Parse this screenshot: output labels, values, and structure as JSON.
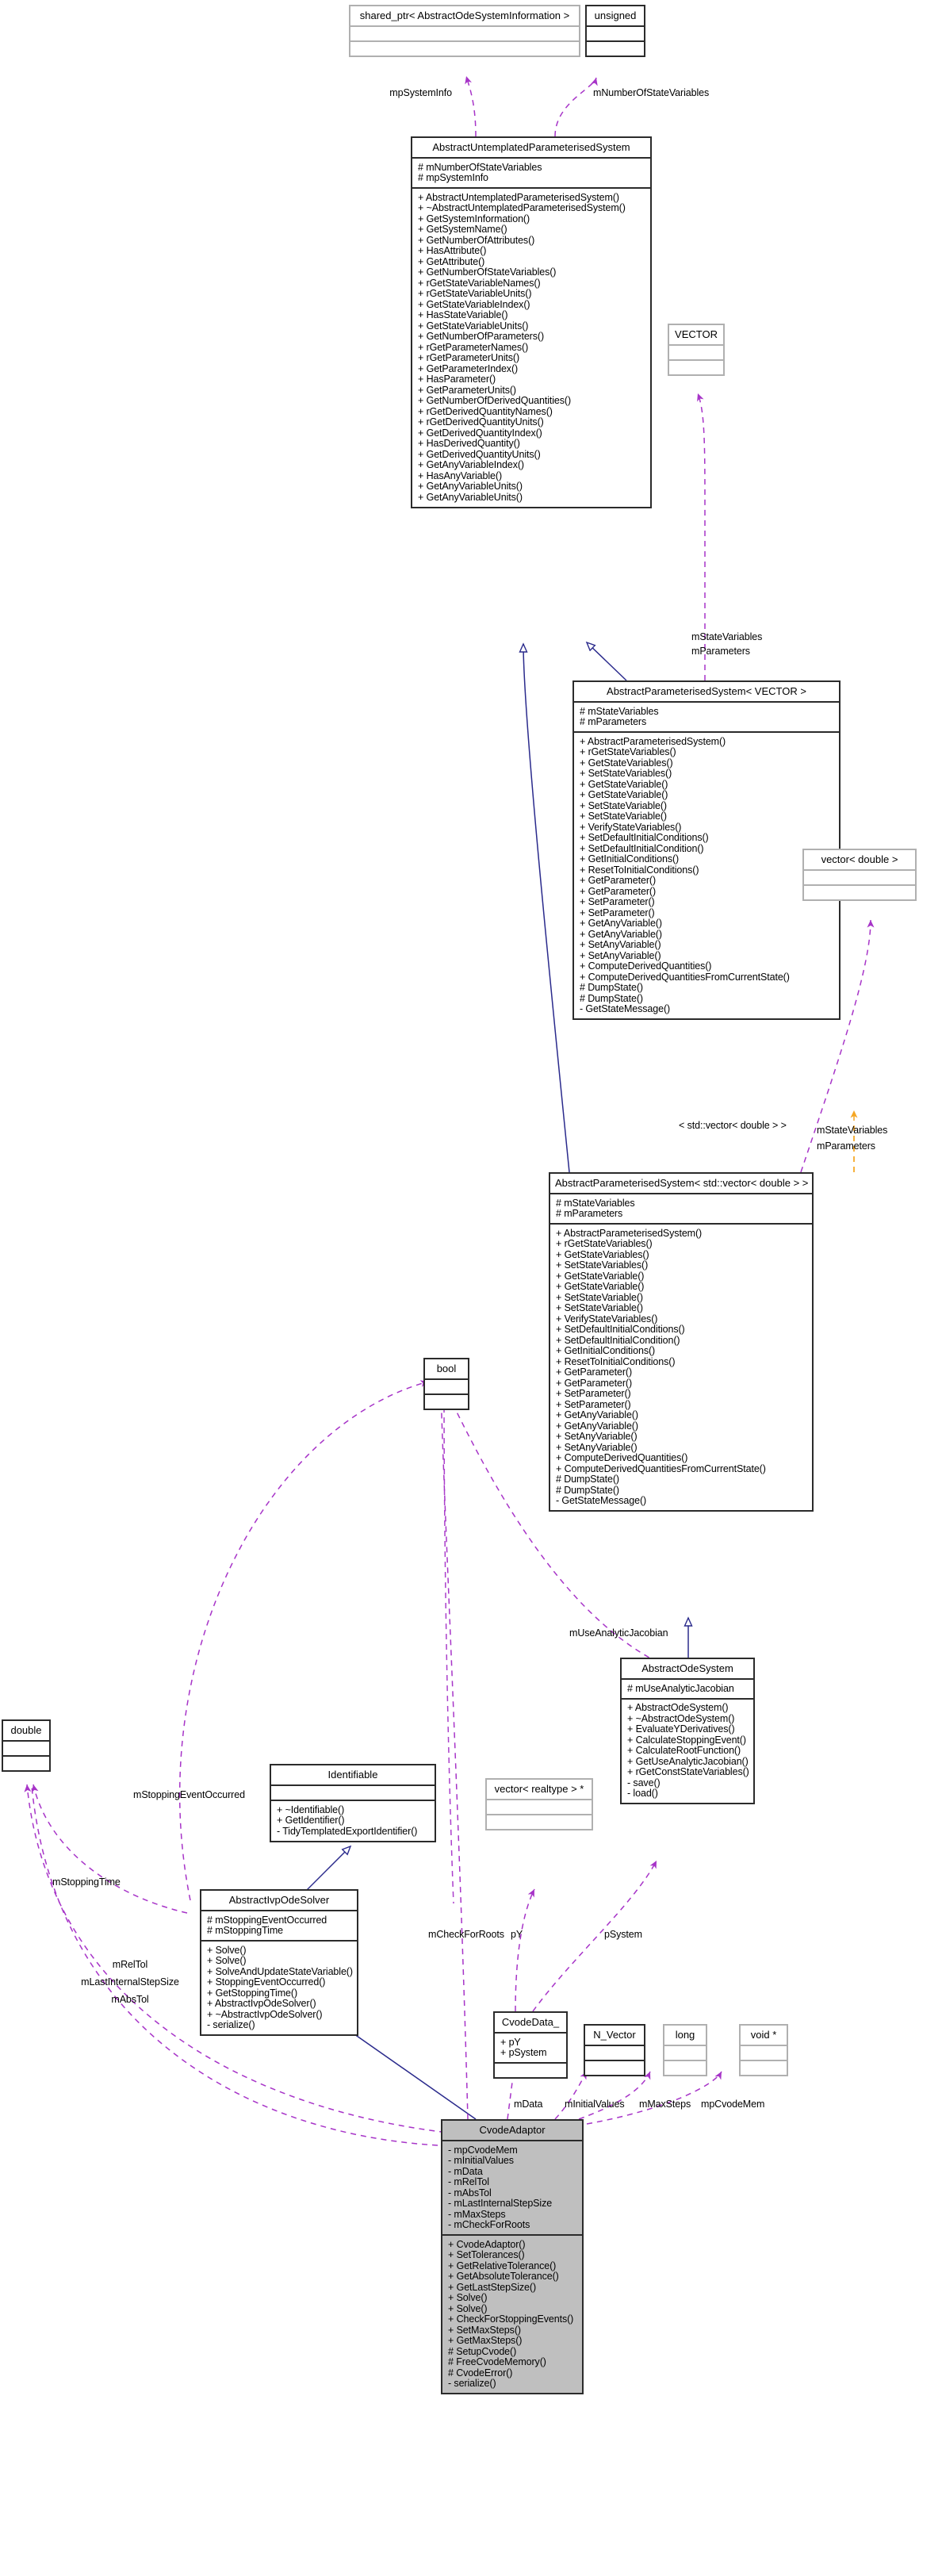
{
  "diagram": {
    "kind": "uml-collaboration-diagram",
    "root_class": "CvodeAdaptor",
    "colors": {
      "node_border": "#2b2b2b",
      "node_border_light": "#b0b0b0",
      "node_fill": "#ffffff",
      "root_fill": "#bfbfbf",
      "inheritance_edge": "#2a2a8c",
      "usage_edge": "#a734c8",
      "template_edge": "#f5a623",
      "background": "#ffffff"
    }
  },
  "nodes": {
    "shared_ptr_info": {
      "title": "shared_ptr< AbstractOdeSystemInformation >",
      "attributes": [],
      "operations": []
    },
    "unsigned": {
      "title": "unsigned",
      "attributes": [],
      "operations": []
    },
    "aups": {
      "title": "AbstractUntemplatedParameterisedSystem",
      "attributes": [
        "# mNumberOfStateVariables",
        "# mpSystemInfo"
      ],
      "operations": [
        "+ AbstractUntemplatedParameterisedSystem()",
        "+ ~AbstractUntemplatedParameterisedSystem()",
        "+ GetSystemInformation()",
        "+ GetSystemName()",
        "+ GetNumberOfAttributes()",
        "+ HasAttribute()",
        "+ GetAttribute()",
        "+ GetNumberOfStateVariables()",
        "+ rGetStateVariableNames()",
        "+ rGetStateVariableUnits()",
        "+ GetStateVariableIndex()",
        "+ HasStateVariable()",
        "+ GetStateVariableUnits()",
        "+ GetNumberOfParameters()",
        "+ rGetParameterNames()",
        "+ rGetParameterUnits()",
        "+ GetParameterIndex()",
        "+ HasParameter()",
        "+ GetParameterUnits()",
        "+ GetNumberOfDerivedQuantities()",
        "+ rGetDerivedQuantityNames()",
        "+ rGetDerivedQuantityUnits()",
        "+ GetDerivedQuantityIndex()",
        "+ HasDerivedQuantity()",
        "+ GetDerivedQuantityUnits()",
        "+ GetAnyVariableIndex()",
        "+ HasAnyVariable()",
        "+ GetAnyVariableUnits()",
        "+ GetAnyVariableUnits()"
      ]
    },
    "vector_tpl": {
      "title": "VECTOR",
      "attributes": [],
      "operations": []
    },
    "aps_vector": {
      "title": "AbstractParameterisedSystem< VECTOR >",
      "attributes": [
        "# mStateVariables",
        "# mParameters"
      ],
      "operations": [
        "+ AbstractParameterisedSystem()",
        "+ rGetStateVariables()",
        "+ GetStateVariables()",
        "+ SetStateVariables()",
        "+ GetStateVariable()",
        "+ GetStateVariable()",
        "+ SetStateVariable()",
        "+ SetStateVariable()",
        "+ VerifyStateVariables()",
        "+ SetDefaultInitialConditions()",
        "+ SetDefaultInitialCondition()",
        "+ GetInitialConditions()",
        "+ ResetToInitialConditions()",
        "+ GetParameter()",
        "+ GetParameter()",
        "+ SetParameter()",
        "+ SetParameter()",
        "+ GetAnyVariable()",
        "+ GetAnyVariable()",
        "+ SetAnyVariable()",
        "+ SetAnyVariable()",
        "+ ComputeDerivedQuantities()",
        "+ ComputeDerivedQuantitiesFromCurrentState()",
        "# DumpState()",
        "# DumpState()",
        "- GetStateMessage()"
      ]
    },
    "vector_double": {
      "title": "vector< double >",
      "attributes": [],
      "operations": []
    },
    "aps_stdvector": {
      "title": "AbstractParameterisedSystem< std::vector< double > >",
      "attributes": [
        "# mStateVariables",
        "# mParameters"
      ],
      "operations": [
        "+ AbstractParameterisedSystem()",
        "+ rGetStateVariables()",
        "+ GetStateVariables()",
        "+ SetStateVariables()",
        "+ GetStateVariable()",
        "+ GetStateVariable()",
        "+ SetStateVariable()",
        "+ SetStateVariable()",
        "+ VerifyStateVariables()",
        "+ SetDefaultInitialConditions()",
        "+ SetDefaultInitialCondition()",
        "+ GetInitialConditions()",
        "+ ResetToInitialConditions()",
        "+ GetParameter()",
        "+ GetParameter()",
        "+ SetParameter()",
        "+ SetParameter()",
        "+ GetAnyVariable()",
        "+ GetAnyVariable()",
        "+ SetAnyVariable()",
        "+ SetAnyVariable()",
        "+ ComputeDerivedQuantities()",
        "+ ComputeDerivedQuantitiesFromCurrentState()",
        "# DumpState()",
        "# DumpState()",
        "- GetStateMessage()"
      ]
    },
    "bool": {
      "title": "bool",
      "attributes": [],
      "operations": []
    },
    "abstract_ode_system": {
      "title": "AbstractOdeSystem",
      "attributes": [
        "# mUseAnalyticJacobian"
      ],
      "operations": [
        "+ AbstractOdeSystem()",
        "+ ~AbstractOdeSystem()",
        "+ EvaluateYDerivatives()",
        "+ CalculateStoppingEvent()",
        "+ CalculateRootFunction()",
        "+ GetUseAnalyticJacobian()",
        "+ rGetConstStateVariables()",
        "- save()",
        "- load()"
      ]
    },
    "double": {
      "title": "double",
      "attributes": [],
      "operations": []
    },
    "identifiable": {
      "title": "Identifiable",
      "attributes": [],
      "operations": [
        "+ ~Identifiable()",
        "+ GetIdentifier()",
        "- TidyTemplatedExportIdentifier()"
      ]
    },
    "vector_realtype": {
      "title": "vector< realtype > *",
      "attributes": [],
      "operations": []
    },
    "abstract_ivp_ode_solver": {
      "title": "AbstractIvpOdeSolver",
      "attributes": [
        "# mStoppingEventOccurred",
        "# mStoppingTime"
      ],
      "operations": [
        "+ Solve()",
        "+ Solve()",
        "+ SolveAndUpdateStateVariable()",
        "+ StoppingEventOccurred()",
        "+ GetStoppingTime()",
        "+ AbstractIvpOdeSolver()",
        "+ ~AbstractIvpOdeSolver()",
        "- serialize()"
      ]
    },
    "cvode_data": {
      "title": "CvodeData_",
      "attributes": [
        "+ pY",
        "+ pSystem"
      ],
      "operations": []
    },
    "n_vector": {
      "title": "N_Vector",
      "attributes": [],
      "operations": []
    },
    "long": {
      "title": "long",
      "attributes": [],
      "operations": []
    },
    "void_ptr": {
      "title": "void *",
      "attributes": [],
      "operations": []
    },
    "cvode_adaptor": {
      "title": "CvodeAdaptor",
      "attributes": [
        "- mpCvodeMem",
        "- mInitialValues",
        "- mData",
        "- mRelTol",
        "- mAbsTol",
        "- mLastInternalStepSize",
        "- mMaxSteps",
        "- mCheckForRoots"
      ],
      "operations": [
        "+ CvodeAdaptor()",
        "+ SetTolerances()",
        "+ GetRelativeTolerance()",
        "+ GetAbsoluteTolerance()",
        "+ GetLastStepSize()",
        "+ Solve()",
        "+ Solve()",
        "+ CheckForStoppingEvents()",
        "+ SetMaxSteps()",
        "+ GetMaxSteps()",
        "# SetupCvode()",
        "# FreeCvodeMemory()",
        "# CvodeError()",
        "- serialize()"
      ]
    }
  },
  "edge_labels": {
    "mp_system_info": "mpSystemInfo",
    "m_number_of_state_variables": "mNumberOfStateVariables",
    "m_state_variables_parameters_top": "mStateVariables\nmParameters",
    "m_state_variables_top": "mStateVariables",
    "m_parameters_top": "mParameters",
    "template_binding": "< std::vector< double > >",
    "m_state_variables_right": "mStateVariables",
    "m_parameters_right": "mParameters",
    "m_use_analytic_jacobian": "mUseAnalyticJacobian",
    "m_stopping_event_occurred": "mStoppingEventOccurred",
    "m_stopping_time": "mStoppingTime",
    "m_rel_tol": "mRelTol",
    "m_last_internal_step_size": "mLastInternalStepSize",
    "m_abs_tol": "mAbsTol",
    "m_check_for_roots": "mCheckForRoots",
    "p_y": "pY",
    "p_system": "pSystem",
    "m_data": "mData",
    "m_initial_values": "mInitialValues",
    "m_max_steps": "mMaxSteps",
    "mp_cvode_mem": "mpCvodeMem"
  }
}
